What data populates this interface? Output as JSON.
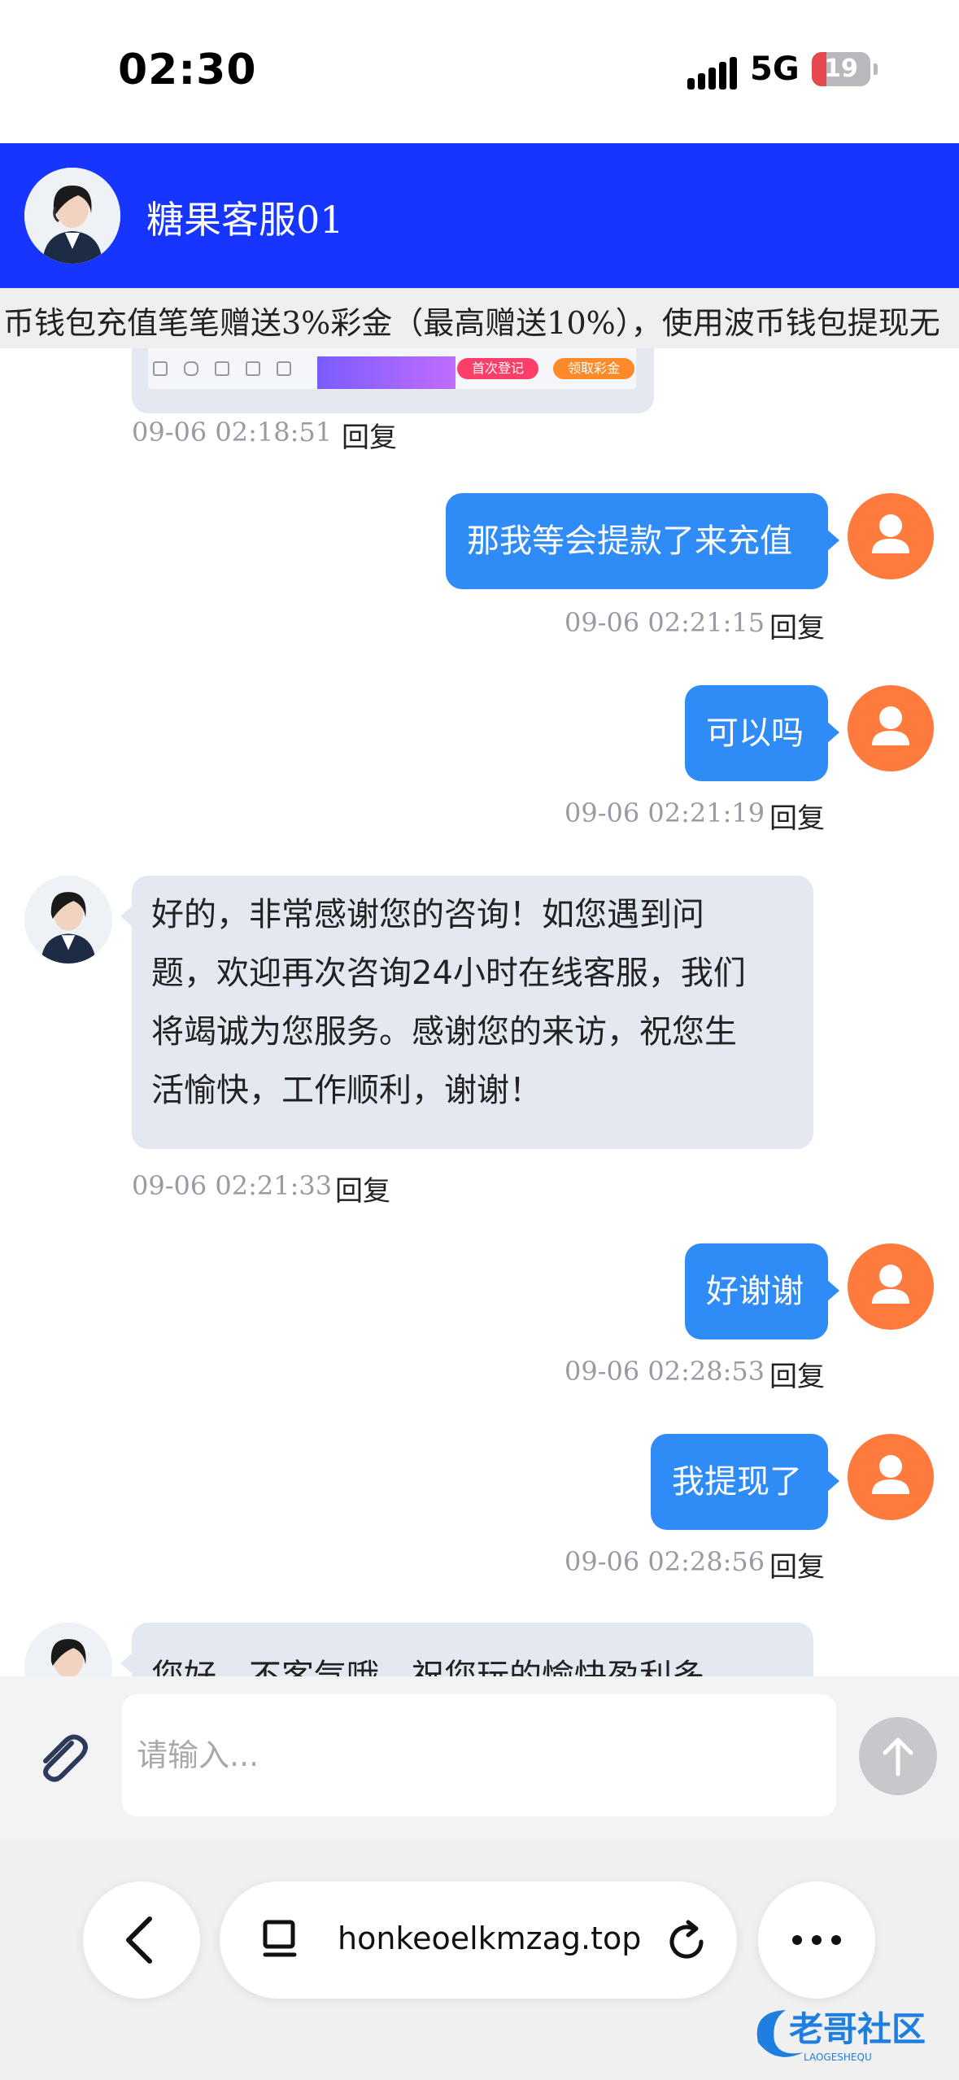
{
  "status": {
    "time": "02:30",
    "network": "5G",
    "battery": "19"
  },
  "header": {
    "title": "糖果客服01"
  },
  "notice": {
    "text": "币钱包充值笔笔赠送3%彩金（最高赠送10%），使用波币钱包提现无"
  },
  "preview": {
    "btn1": "首次登记",
    "btn2": "领取彩金"
  },
  "messages": [
    {
      "side": "left",
      "time": "09-06 02:18:51",
      "reply": "回复"
    },
    {
      "side": "right",
      "text": "那我等会提款了来充值",
      "time": "09-06 02:21:15",
      "reply": "回复"
    },
    {
      "side": "right",
      "text": "可以吗",
      "time": "09-06 02:21:19",
      "reply": "回复"
    },
    {
      "side": "left",
      "lines": [
        "好的，非常感谢您的咨询！如您遇到问",
        "题，欢迎再次咨询24小时在线客服，我们",
        "将竭诚为您服务。感谢您的来访，祝您生",
        "活愉快，工作顺利，谢谢！"
      ],
      "time": "09-06 02:21:33",
      "reply": "回复"
    },
    {
      "side": "right",
      "text": "好谢谢",
      "time": "09-06 02:28:53",
      "reply": "回复"
    },
    {
      "side": "right",
      "text": "我提现了",
      "time": "09-06 02:28:56",
      "reply": "回复"
    },
    {
      "side": "left",
      "text": "您好，不客气哦，祝您玩的愉快盈利多"
    }
  ],
  "input": {
    "placeholder": "请输入..."
  },
  "browser": {
    "url": "honkeoelkmzag.top"
  },
  "watermark": {
    "text": "老哥社区",
    "sub": "LAOGESHEQU"
  },
  "colors": {
    "header": "#1636ff",
    "bubble_right": "#2f8bf6",
    "bubble_left": "#e3e8f1",
    "user_avatar": "#ff7a3d"
  }
}
